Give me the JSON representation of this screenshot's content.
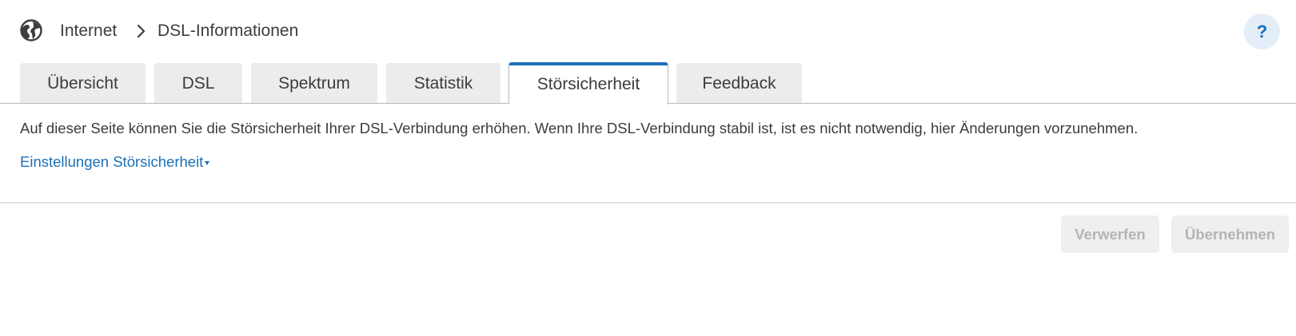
{
  "breadcrumb": {
    "icon": "globe-icon",
    "items": [
      "Internet",
      "DSL-Informationen"
    ],
    "separator_icon": "chevron-right-icon"
  },
  "help": {
    "label": "?"
  },
  "tabs": [
    {
      "label": "Übersicht",
      "active": false
    },
    {
      "label": "DSL",
      "active": false
    },
    {
      "label": "Spektrum",
      "active": false
    },
    {
      "label": "Statistik",
      "active": false
    },
    {
      "label": "Störsicherheit",
      "active": true
    },
    {
      "label": "Feedback",
      "active": false
    }
  ],
  "content": {
    "intro": "Auf dieser Seite können Sie die Störsicherheit Ihrer DSL-Verbindung erhöhen. Wenn Ihre DSL-Verbindung stabil ist, ist es nicht notwendig, hier Änderungen vorzunehmen.",
    "settings_link": "Einstellungen Störsicherheit"
  },
  "footer": {
    "discard_label": "Verwerfen",
    "apply_label": "Übernehmen",
    "buttons_disabled": true
  },
  "colors": {
    "accent": "#1d6fb8",
    "text": "#3c3c3c",
    "tab_bg": "#ececec",
    "disabled_text": "#b4b4b4"
  }
}
